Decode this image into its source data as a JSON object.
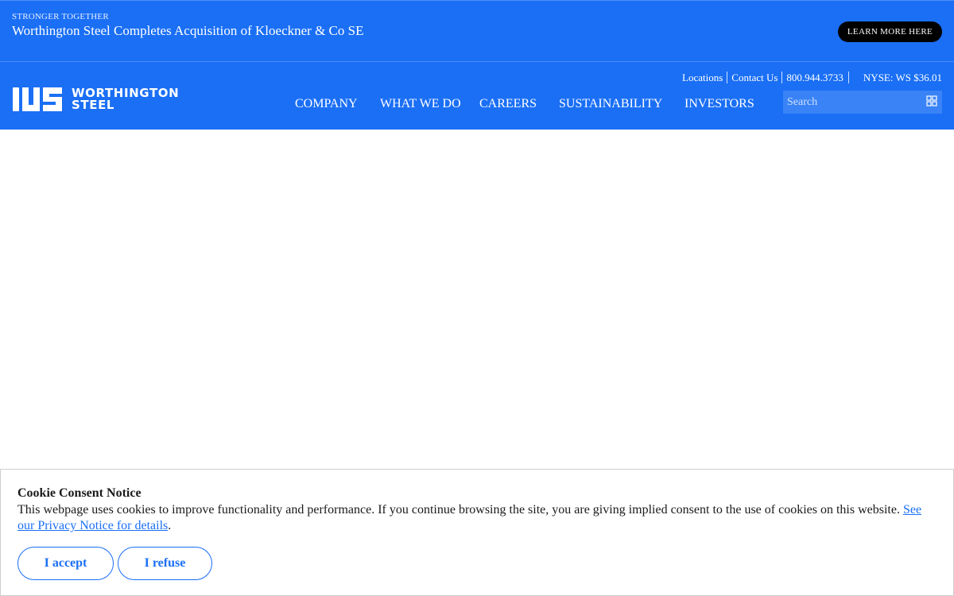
{
  "banner": {
    "eyebrow": "STRONGER TOGETHER",
    "title": "Worthington Steel Completes Acquisition of Kloeckner & Co SE",
    "cta_label": "LEARN MORE HERE"
  },
  "header": {
    "logo_line1": "WORTHINGTON",
    "logo_line2": "STEEL",
    "utility_links": [
      "Locations",
      "Contact Us",
      "800.944.3733"
    ],
    "ticker": "NYSE: WS $36.01",
    "nav": [
      "COMPANY",
      "WHAT WE DO",
      "CAREERS",
      "SUSTAINABILITY",
      "INVESTORS"
    ],
    "search_placeholder": "Search",
    "search_icon": "grid-search-icon"
  },
  "cookie": {
    "title": "Cookie Consent Notice",
    "body": "This webpage uses cookies to improve functionality and performance. If you continue browsing the site, you are giving implied consent to the use of cookies on this website.",
    "link_text": "See our Privacy Notice for details",
    "trailing": ".",
    "accept_label": "I accept",
    "refuse_label": "I refuse"
  },
  "colors": {
    "brand_blue": "#1a6ff5",
    "cta_black": "#000000"
  }
}
